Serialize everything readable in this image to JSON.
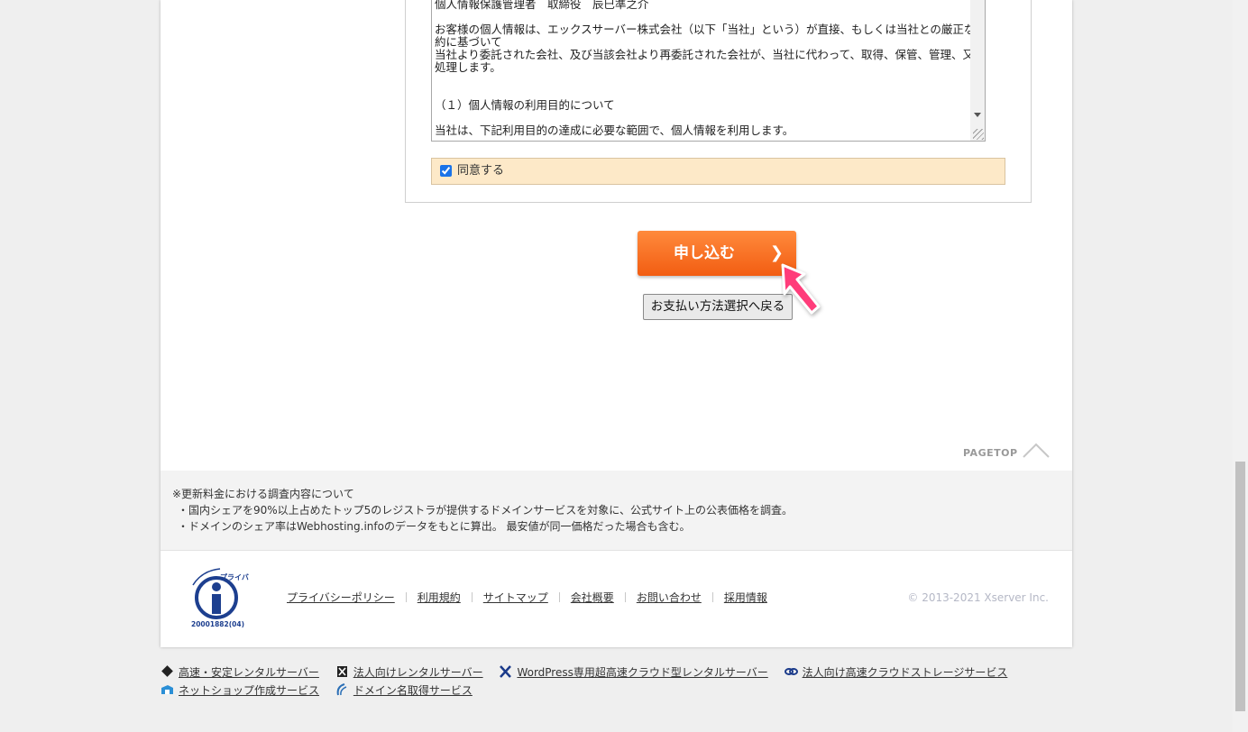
{
  "terms": {
    "lines": [
      "個人情報保護管理者　取締役　辰巳準之介",
      "",
      "お客様の個人情報は、エックスサーバー株式会社（以下「当社」という）が直接、もしくは当社との厳正な契約に基づいて",
      "当社より委託された会社、及び当該会社より再委託された会社が、当社に代わって、取得、保管、管理、又は処理します。",
      "",
      "",
      "（１）個人情報の利用目的について",
      "",
      "当社は、下記利用目的の達成に必要な範囲で、個人情報を利用します。"
    ]
  },
  "agree": {
    "label": "同意する",
    "checked": true
  },
  "buttons": {
    "submit_label": "申し込む",
    "back_label": "お支払い方法選択へ戻る"
  },
  "pagetop": {
    "label": "PAGETOP"
  },
  "notes": {
    "title": "※更新料金における調査内容について",
    "items": [
      "・国内シェアを90%以上占めたトップ5のレジストラが提供するドメインサービスを対象に、公式サイト上の公表価格を調査。",
      "・ドメインのシェア率はWebhosting.infoのデータをもとに算出。 最安値が同一価格だった場合も含む。"
    ]
  },
  "footer": {
    "privacy_mark_text": "たいせつにします プライバシー",
    "privacy_mark_number": "20001882(04)",
    "links": [
      "プライバシーポリシー",
      "利用規約",
      "サイトマップ",
      "会社概要",
      "お問い合わせ",
      "採用情報"
    ],
    "copyright": "© 2013-2021 Xserver Inc."
  },
  "bottom_links": [
    {
      "label": "高速・安定レンタルサーバー",
      "icon": "xserver-icon"
    },
    {
      "label": "法人向けレンタルサーバー",
      "icon": "xserver-business-icon"
    },
    {
      "label": "WordPress専用超高速クラウド型レンタルサーバー",
      "icon": "wpx-icon"
    },
    {
      "label": "法人向け高速クラウドストレージサービス",
      "icon": "cloud-storage-icon"
    },
    {
      "label": "ネットショップ作成サービス",
      "icon": "shop-icon"
    },
    {
      "label": "ドメイン名取得サービス",
      "icon": "domain-icon"
    }
  ],
  "colors": {
    "submit_button": "#f25d12",
    "agree_background": "#fde9c8",
    "cursor_pink": "#ff3c7a"
  }
}
